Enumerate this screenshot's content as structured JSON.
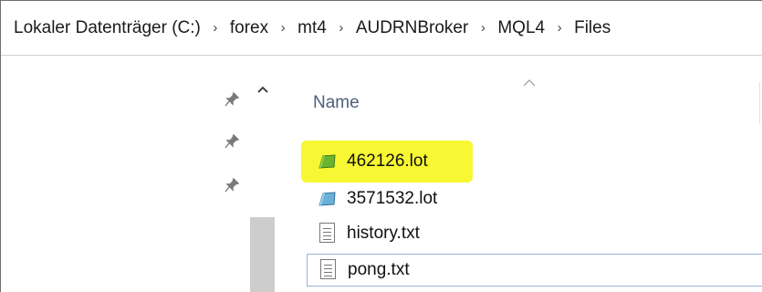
{
  "addressbar": {
    "crumbs": [
      "Lokaler Datenträger (C:)",
      "forex",
      "mt4",
      "AUDRNBroker",
      "MQL4",
      "Files"
    ],
    "separator": "›"
  },
  "navpane": {
    "pins": [
      "pin-icon",
      "pin-icon",
      "pin-icon"
    ],
    "scroll_up": "⌃"
  },
  "filelist": {
    "sort_indicator": "^",
    "column_name": "Name",
    "files": [
      {
        "name": "462126.lot",
        "icon": "lot-file-green-icon",
        "highlighted": true,
        "highlight_color": "#f7f733"
      },
      {
        "name": "3571532.lot",
        "icon": "lot-file-blue-icon",
        "highlighted": false
      },
      {
        "name": "history.txt",
        "icon": "text-file-icon",
        "highlighted": false
      },
      {
        "name": "pong.txt",
        "icon": "text-file-icon",
        "highlighted": false,
        "focused": true
      }
    ]
  }
}
